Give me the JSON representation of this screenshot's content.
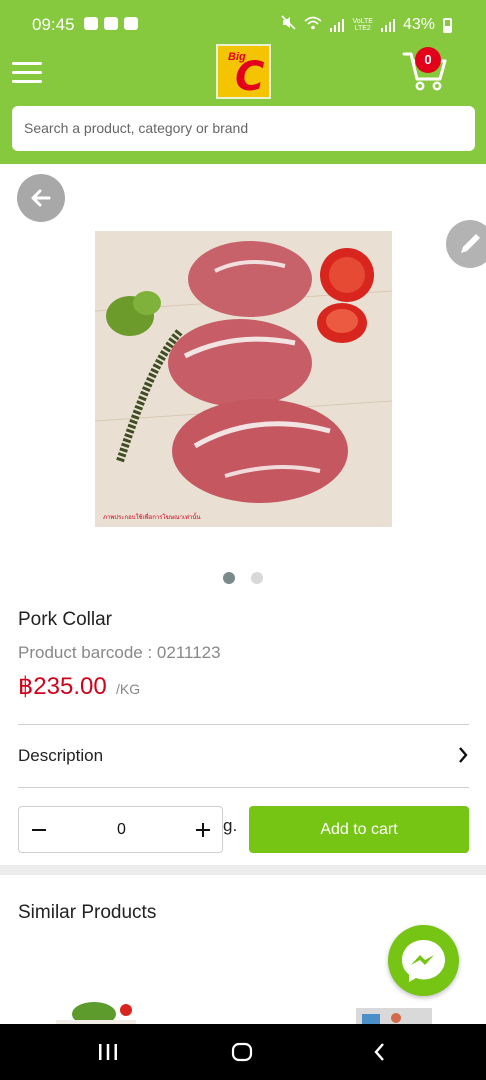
{
  "status_bar": {
    "time": "09:45",
    "battery": "43%",
    "lte_label": "LTE2",
    "volte_label": "VoLTE"
  },
  "header": {
    "logo_big": "Big",
    "logo_c": "C",
    "cart_count": "0"
  },
  "search": {
    "placeholder": "Search a product, category or brand"
  },
  "product": {
    "name": "Pork Collar",
    "barcode": "Product barcode : 0211123",
    "price": "฿235.00",
    "unit": "/KG",
    "image_caption": "ภาพประกอบใช้เพื่อการโฆษณาเท่านั้น",
    "image_dots": 2,
    "active_dot": 0
  },
  "description": {
    "label": "Description"
  },
  "quantity": {
    "value": "0",
    "unit_suffix": "g."
  },
  "actions": {
    "add_to_cart": "Add to cart"
  },
  "similar": {
    "title": "Similar Products"
  },
  "colors": {
    "brand_green": "#86c83e",
    "button_green": "#76c414",
    "price_red": "#d0021b",
    "badge_red": "#e2001a"
  }
}
